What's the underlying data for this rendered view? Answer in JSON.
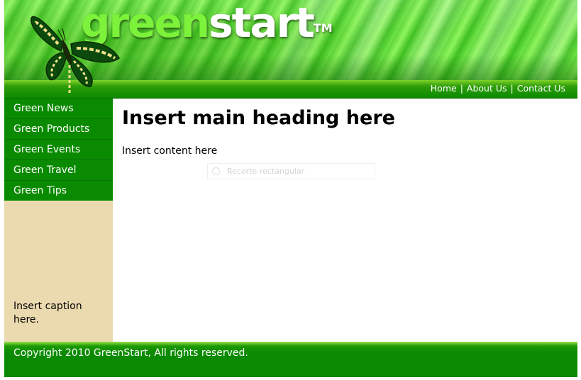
{
  "header": {
    "logo_part1": "green",
    "logo_part2": "start",
    "logo_tm": "TM"
  },
  "topnav": {
    "items": [
      "Home",
      "About Us",
      "Contact Us"
    ],
    "separator": "|"
  },
  "sidebar": {
    "items": [
      {
        "label": "Green News"
      },
      {
        "label": "Green Products"
      },
      {
        "label": "Green Events"
      },
      {
        "label": "Green Travel"
      },
      {
        "label": "Green Tips"
      }
    ],
    "caption": "Insert caption here."
  },
  "main": {
    "heading": "Insert main heading here",
    "content": "Insert content here"
  },
  "tooltip": {
    "label": "Recorte rectangular",
    "icon": "circle-icon"
  },
  "footer": {
    "copyright": "Copyright 2010 GreenStart, All rights reserved."
  },
  "colors": {
    "nav_green": "#0a8a00",
    "sidebar_beige": "#ebdaaf",
    "logo_green": "#7cf23a"
  }
}
